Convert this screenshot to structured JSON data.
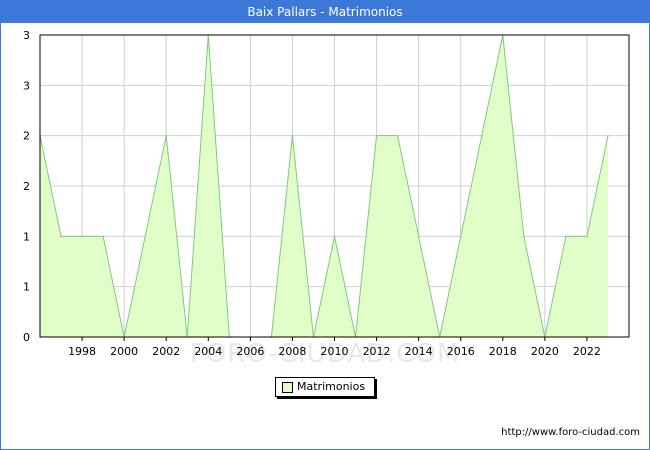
{
  "window": {
    "title": "Baix Pallars - Matrimonios"
  },
  "chart_data": {
    "type": "area",
    "title": "Baix Pallars - Matrimonios",
    "xlabel": "",
    "ylabel": "",
    "x": [
      1996,
      1997,
      1998,
      1999,
      2000,
      2001,
      2002,
      2003,
      2004,
      2005,
      2006,
      2007,
      2008,
      2009,
      2010,
      2011,
      2012,
      2013,
      2014,
      2015,
      2016,
      2017,
      2018,
      2019,
      2020,
      2021,
      2022,
      2023
    ],
    "series": [
      {
        "name": "Matrimonios",
        "values": [
          2,
          1,
          1,
          1,
          0,
          1,
          2,
          0,
          3,
          0,
          0,
          0,
          2,
          0,
          1,
          0,
          2,
          2,
          1,
          0,
          1,
          2,
          3,
          1,
          0,
          1,
          1,
          2
        ]
      }
    ],
    "xlim": [
      1996,
      2024
    ],
    "ylim": [
      0,
      3
    ],
    "x_ticks": [
      "1998",
      "2000",
      "2002",
      "2004",
      "2006",
      "2008",
      "2010",
      "2012",
      "2014",
      "2016",
      "2018",
      "2020",
      "2022"
    ],
    "y_ticks": [
      "0",
      "1",
      "1",
      "2",
      "2",
      "3",
      "3"
    ],
    "grid": true,
    "legend_position": "bottom-center",
    "colors": {
      "fill": "#e2fec8",
      "line": "#80c880",
      "grid": "#d0d0d0",
      "title_bar": "#3c78d8"
    }
  },
  "legend": {
    "label": "Matrimonios"
  },
  "watermark": "FORO-CIUDAD.COM",
  "source": "http://www.foro-ciudad.com"
}
